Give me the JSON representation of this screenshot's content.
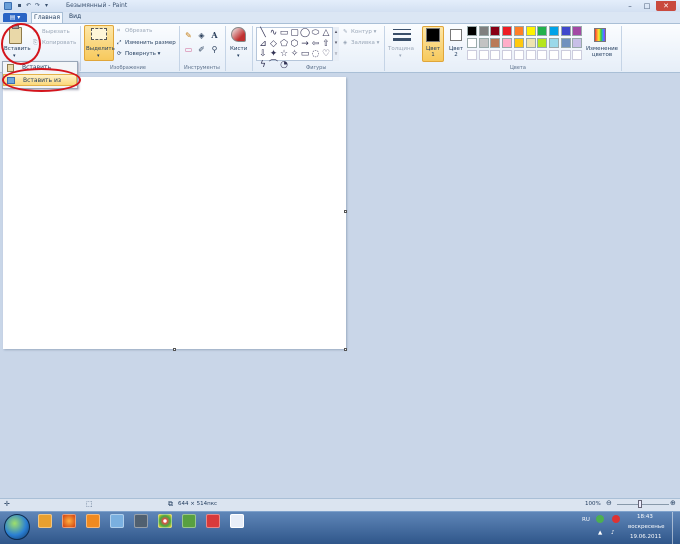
{
  "window": {
    "title": "Безымянный - Paint",
    "qat_glyphs": [
      "▪",
      "↶",
      "↷",
      "▾"
    ],
    "controls": {
      "minimize": "–",
      "maximize": "□",
      "close": "✕"
    }
  },
  "tabs": {
    "file": "▤ ▾",
    "home": "Главная",
    "view": "Вид"
  },
  "ribbon": {
    "clipboard": {
      "paste": "Вставить",
      "cut": "Вырезать",
      "copy": "Копировать"
    },
    "image": {
      "select": "Выделить",
      "crop": "Обрезать",
      "resize": "Изменить размер",
      "rotate": "Повернуть ▾",
      "group": "Изображение"
    },
    "tools": {
      "group": "Инструменты",
      "items": [
        "pencil-icon",
        "fill-icon",
        "text-icon",
        "eraser-icon",
        "color-picker-icon",
        "magnifier-icon"
      ],
      "glyphs": [
        "✎",
        "◈",
        "A",
        "▭",
        "✐",
        "⚲"
      ]
    },
    "brushes": {
      "label": "Кисти"
    },
    "shapes": {
      "group": "Фигуры",
      "outline": "Контур ▾",
      "fill": "Заливка ▾",
      "glyphs": [
        "╲",
        "∿",
        "▭",
        "▢",
        "◯",
        "⬭",
        "△",
        "⊿",
        "◇",
        "⬠",
        "⬡",
        "→",
        "⇦",
        "⇧",
        "⇩",
        "✦",
        "☆",
        "✧",
        "▭",
        "◌",
        "♡",
        "ϟ",
        "⌒",
        "◔"
      ]
    },
    "thickness": "Толщина",
    "colors": {
      "group": "Цвета",
      "color1": "Цвет\n1",
      "color2": "Цвет\n2",
      "edit": "Изменение цветов",
      "palette_row1": [
        "#000000",
        "#7f7f7f",
        "#880015",
        "#ed1c24",
        "#ff7f27",
        "#fff200",
        "#22b14c",
        "#00a2e8",
        "#3f48cc",
        "#a349a4"
      ],
      "palette_row2": [
        "#ffffff",
        "#c3c3c3",
        "#b97a57",
        "#ffaec9",
        "#ffc90e",
        "#efe4b0",
        "#b5e61d",
        "#99d9ea",
        "#7092be",
        "#c8bfe7"
      ]
    }
  },
  "paste_menu": {
    "item1": "Вставить",
    "item2": "Вставить из"
  },
  "status": {
    "canvas_size": "644 × 514пкс",
    "zoom": "100%"
  },
  "taskbar": {
    "lang": "RU",
    "time": "18:43",
    "day": "воскресенье",
    "date": "19.06.2011"
  }
}
